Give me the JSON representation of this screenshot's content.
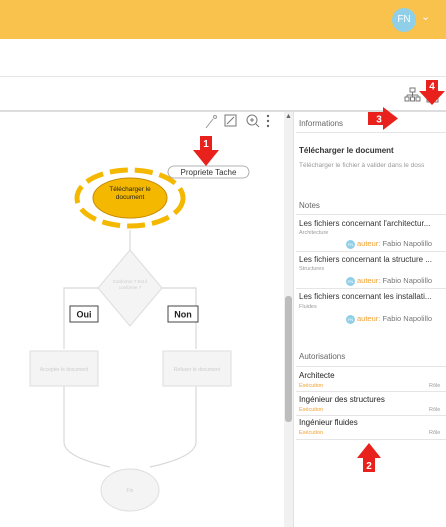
{
  "header": {
    "avatar_initials": "FN",
    "chevron": "⌄"
  },
  "callouts": {
    "n1": "1",
    "n2": "2",
    "n3": "3",
    "n4": "4",
    "color": "#e8211c"
  },
  "toolbar": {
    "icons": [
      "org-chart-icon",
      "document-icon"
    ]
  },
  "diagram": {
    "tooltip": "Propriete Tache",
    "start_task": "Télécharger le document",
    "decision": "Conforme ? Est il conforme ?",
    "yes_label": "Oui",
    "no_label": "Non",
    "left_task": "Accepter le document",
    "right_task": "Refuser le document",
    "end": "Fin",
    "accent": "#f5b800"
  },
  "panel": {
    "informations_title": "Informations",
    "task_title": "Télécharger le document",
    "task_desc": "Télécharger le fichier à valider dans le doss",
    "notes_title": "Notes",
    "notes": [
      {
        "title": "Les fichiers concernant l'architectur...",
        "category": "Architecture",
        "author_label": "auteur:",
        "author": "Fabio Napolillo"
      },
      {
        "title": "Les fichiers concernant la structure ...",
        "category": "Structures",
        "author_label": "auteur:",
        "author": "Fabio Napolillo"
      },
      {
        "title": "Les fichiers concernant les installati...",
        "category": "Fluides",
        "author_label": "auteur:",
        "author": "Fabio Napolillo"
      }
    ],
    "auth_title": "Autorisations",
    "authorizations": [
      {
        "name": "Architecte",
        "type": "Exécution",
        "role": "Rôle"
      },
      {
        "name": "Ingénieur des structures",
        "type": "Exécution",
        "role": "Rôle"
      },
      {
        "name": "Ingénieur fluides",
        "type": "Exécution",
        "role": "Rôle"
      }
    ]
  }
}
